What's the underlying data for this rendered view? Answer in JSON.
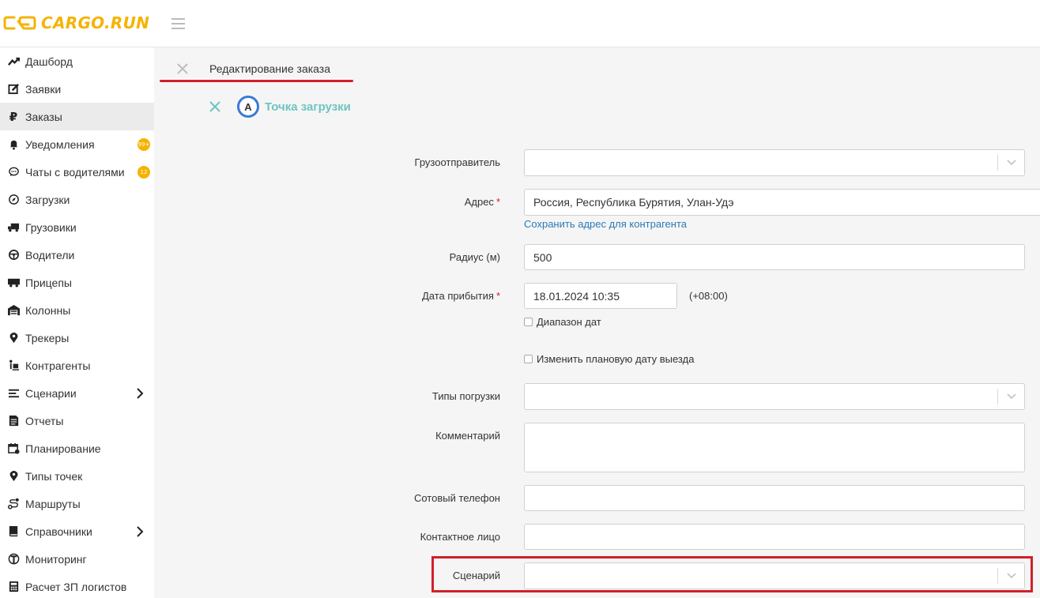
{
  "brand": {
    "name": "CARGO.RUN"
  },
  "sidebar": {
    "items": [
      {
        "label": "Дашборд",
        "icon": "dashboard-icon"
      },
      {
        "label": "Заявки",
        "icon": "edit-icon"
      },
      {
        "label": "Заказы",
        "icon": "ruble-icon",
        "active": true
      },
      {
        "label": "Уведомления",
        "icon": "bell-icon",
        "badge": "99+"
      },
      {
        "label": "Чаты с водителями",
        "icon": "chat-icon",
        "badge": "12"
      },
      {
        "label": "Загрузки",
        "icon": "compass-icon"
      },
      {
        "label": "Грузовики",
        "icon": "truck-icon"
      },
      {
        "label": "Водители",
        "icon": "steering-wheel-icon"
      },
      {
        "label": "Прицепы",
        "icon": "trailer-icon"
      },
      {
        "label": "Колонны",
        "icon": "warehouse-icon"
      },
      {
        "label": "Трекеры",
        "icon": "map-pin-icon"
      },
      {
        "label": "Контрагенты",
        "icon": "person-dolly-icon"
      },
      {
        "label": "Сценарии",
        "icon": "list-icon",
        "expandable": true
      },
      {
        "label": "Отчеты",
        "icon": "report-icon"
      },
      {
        "label": "Планирование",
        "icon": "calendar-icon"
      },
      {
        "label": "Типы точек",
        "icon": "map-pin-icon"
      },
      {
        "label": "Маршруты",
        "icon": "route-icon"
      },
      {
        "label": "Справочники",
        "icon": "book-icon",
        "expandable": true
      },
      {
        "label": "Мониторинг",
        "icon": "monitoring-icon"
      },
      {
        "label": "Расчет ЗП логистов",
        "icon": "calculator-icon"
      }
    ]
  },
  "tab": {
    "title": "Редактирование заказа"
  },
  "point": {
    "letter": "A",
    "title": "Точка загрузки"
  },
  "form": {
    "shipper": {
      "label": "Грузоотправитель",
      "value": ""
    },
    "address": {
      "label": "Адрес",
      "value": "Россия, Республика Бурятия, Улан-Удэ",
      "required_mark": "*"
    },
    "save_address_link": "Сохранить адрес для контрагента",
    "radius": {
      "label": "Радиус (м)",
      "value": "500"
    },
    "arrival": {
      "label": "Дата прибытия",
      "value": "18.01.2024 10:35",
      "timezone": "(+08:00)",
      "required_mark": "*"
    },
    "date_range": {
      "label": "Диапазон дат",
      "checked": false
    },
    "change_departure": {
      "label": "Изменить плановую дату выезда",
      "checked": false
    },
    "loading_types": {
      "label": "Типы погрузки",
      "value": ""
    },
    "comment": {
      "label": "Комментарий",
      "value": ""
    },
    "phone": {
      "label": "Сотовый телефон",
      "value": ""
    },
    "contact": {
      "label": "Контактное лицо",
      "value": ""
    },
    "scenario": {
      "label": "Сценарий",
      "value": ""
    }
  },
  "colors": {
    "brand": "#f5b301",
    "accent_teal": "#6cc5c0",
    "link": "#2a7ab8",
    "highlight_red": "#d0202a",
    "point_circle": "#3a7bd5"
  }
}
